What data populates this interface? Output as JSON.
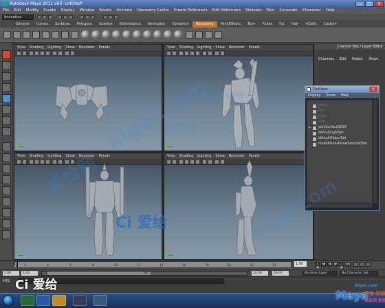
{
  "window": {
    "title": "Autodesk Maya 2011 x64: untitled*",
    "controls": [
      "–",
      "▢",
      "✕"
    ]
  },
  "menubar": [
    "File",
    "Edit",
    "Modify",
    "Create",
    "Display",
    "Window",
    "Assets",
    "Animate",
    "Geometry Cache",
    "Create Deformers",
    "Edit Deformers",
    "Skeleton",
    "Skin",
    "Constrain",
    "Character",
    "Help"
  ],
  "status_line": {
    "mode": "Animation"
  },
  "shelf": {
    "tabs": [
      "General",
      "Curves",
      "Surfaces",
      "Polygons",
      "Subdivs",
      "Deformation",
      "Animation",
      "Dynamics",
      "Rendering",
      "PaintEffects",
      "Toon",
      "Fluids",
      "Fur",
      "Hair",
      "nCloth",
      "Custom"
    ],
    "active_tab": "Rendering"
  },
  "viewport_menu": [
    "View",
    "Shading",
    "Lighting",
    "Show",
    "Renderer",
    "Panels"
  ],
  "channel_box": {
    "header": "Channel Box / Layer Editor",
    "menu": [
      "Channels",
      "Edit",
      "Object",
      "Show"
    ]
  },
  "outliner": {
    "title": "Outliner",
    "close": "✕",
    "menu": [
      "Display",
      "Show",
      "Help"
    ],
    "items": [
      {
        "label": "persp",
        "dim": true
      },
      {
        "label": "top",
        "dim": true
      },
      {
        "label": "front",
        "dim": true
      },
      {
        "label": "side",
        "dim": true
      },
      {
        "label": "polySurface3259",
        "dim": false
      },
      {
        "label": "defaultLightSet",
        "dim": false
      },
      {
        "label": "defaultObjectSet",
        "dim": false
      },
      {
        "label": "modelPanel4ViewSelectedSet",
        "dim": false
      }
    ],
    "expand": "+"
  },
  "timeline": {
    "ticks": [
      "2",
      "4",
      "6",
      "8",
      "10",
      "12",
      "14",
      "16",
      "18",
      "20",
      "22",
      "24"
    ],
    "current_frame": "1.00",
    "playback_buttons": [
      "|◀",
      "◀|",
      "◀",
      "▶",
      "|▶",
      "▶|"
    ]
  },
  "range": {
    "start": "1.00",
    "inner_start": "1.00",
    "slider_value": "24",
    "end": "24.00",
    "anim_end": "48.00",
    "anim_layer": "No Anim Layer",
    "character_set": "No Character Set"
  },
  "command_line": {
    "label": "MEL"
  },
  "watermarks": {
    "center_logo": "Ci 爱给",
    "bottom_left_logo": "Ci 爱给",
    "site": "aigei.com",
    "chinese": "爱给网",
    "corner_top": "Aigei.com",
    "corner_brand": "Maya",
    "corner_cn": "爱给 资源网",
    "corner_sub": "爱给网 家园"
  },
  "colors": {
    "accent_tab": "#c4732a",
    "selected_tool": "#c94b3a",
    "watermark": "#3a8ad0"
  }
}
